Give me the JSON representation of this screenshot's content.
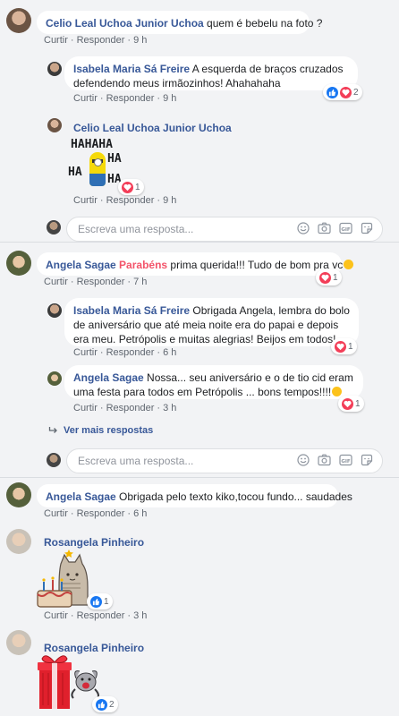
{
  "actions": {
    "like": "Curtir",
    "reply": "Responder",
    "sep": "·"
  },
  "reply_placeholder": "Escreva uma resposta...",
  "comments": [
    {
      "author": "Celio Leal Uchoa Junior Uchoa",
      "text": "quem é bebelu na foto ?",
      "time": "9 h"
    },
    {
      "author": "Isabela Maria Sá Freire",
      "text": "A esquerda de braços cruzados defendendo meus irmãozinhos! Ahahahaha",
      "time": "9 h",
      "reactions": "2"
    },
    {
      "author": "Celio Leal Uchoa Junior Uchoa",
      "text": "",
      "time": "9 h",
      "sticker_text": [
        "HAHAHA",
        "HA",
        "HA",
        "HA"
      ],
      "reactions": "1"
    },
    {
      "author": "Angela Sagae",
      "highlight": "Parabéns",
      "text": "prima querida!!! Tudo de bom pra vc",
      "time": "7 h",
      "reactions": "1"
    },
    {
      "author": "Isabela Maria Sá Freire",
      "text": "Obrigada Angela, lembra do bolo de aniversário que até meia noite era do papai e depois era meu. Petrópolis e muitas alegrias! Beijos em todos!",
      "time": "6 h",
      "reactions": "1"
    },
    {
      "author": "Angela Sagae",
      "text": "Nossa... seu aniversário e o de tio cid eram uma festa para todos em Petrópolis ... bons tempos!!!!",
      "time": "3 h",
      "reactions": "1"
    },
    {
      "author": "Angela Sagae",
      "text": "Obrigada pelo texto kiko,tocou fundo... saudades",
      "time": "6 h"
    },
    {
      "author": "Rosangela Pinheiro",
      "text": "",
      "time": "3 h",
      "reactions": "1"
    },
    {
      "author": "Rosangela Pinheiro",
      "text": "",
      "time": "",
      "reactions": "2"
    }
  ],
  "more_replies": "Ver mais respostas",
  "colors": {
    "link": "#385898",
    "highlight": "#f35369",
    "meta": "#606770",
    "bg": "#f2f3f5",
    "like_blue": "#1877f2",
    "love_red": "#f33e58"
  }
}
